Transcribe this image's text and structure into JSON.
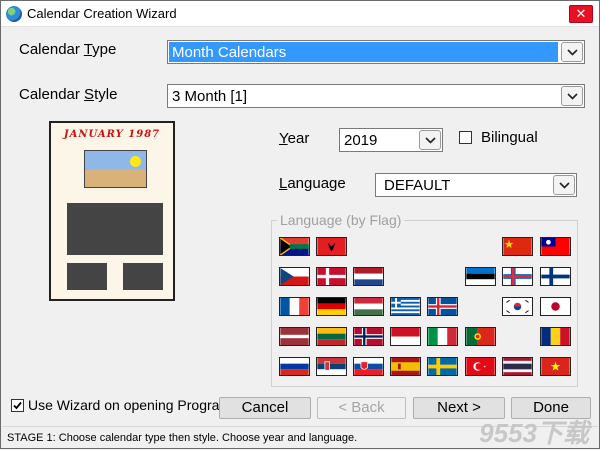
{
  "window": {
    "title": "Calendar Creation Wizard",
    "close": "✕"
  },
  "calendar_type": {
    "label_pre": "Calendar ",
    "label_key": "T",
    "label_post": "ype",
    "value": "Month Calendars"
  },
  "calendar_style": {
    "label_pre": "Calendar ",
    "label_key": "S",
    "label_post": "tyle",
    "value": "3 Month [1]"
  },
  "year": {
    "label_key": "Y",
    "label_post": "ear",
    "value": "2019"
  },
  "bilingual": {
    "label": "Bilingual",
    "checked": false
  },
  "language": {
    "label_key": "L",
    "label_post": "anguage",
    "value": "DEFAULT"
  },
  "flag_group": {
    "label": "Language (by Flag)"
  },
  "preview": {
    "title": "JANUARY 1987"
  },
  "wizard_checkbox": {
    "label": "Use Wizard on opening Program",
    "checked": true
  },
  "buttons": {
    "cancel": "Cancel",
    "back": "< Back",
    "next": "Next >",
    "done": "Done"
  },
  "status": "STAGE 1: Choose calendar type then style. Choose year and language.",
  "watermark": "9553下载",
  "flags": [
    "south-africa",
    "albania",
    "china",
    "taiwan",
    "czech",
    "denmark",
    "netherlands",
    "estonia",
    "faroe",
    "finland",
    "france",
    "germany",
    "hungary",
    "greece",
    "iceland",
    "korea",
    "japan",
    "latvia",
    "lithuania",
    "norway",
    "indonesia",
    "italy",
    "portugal",
    "romania",
    "russia",
    "serbia",
    "slovakia",
    "spain",
    "sweden",
    "turkey",
    "thailand",
    "vietnam"
  ]
}
